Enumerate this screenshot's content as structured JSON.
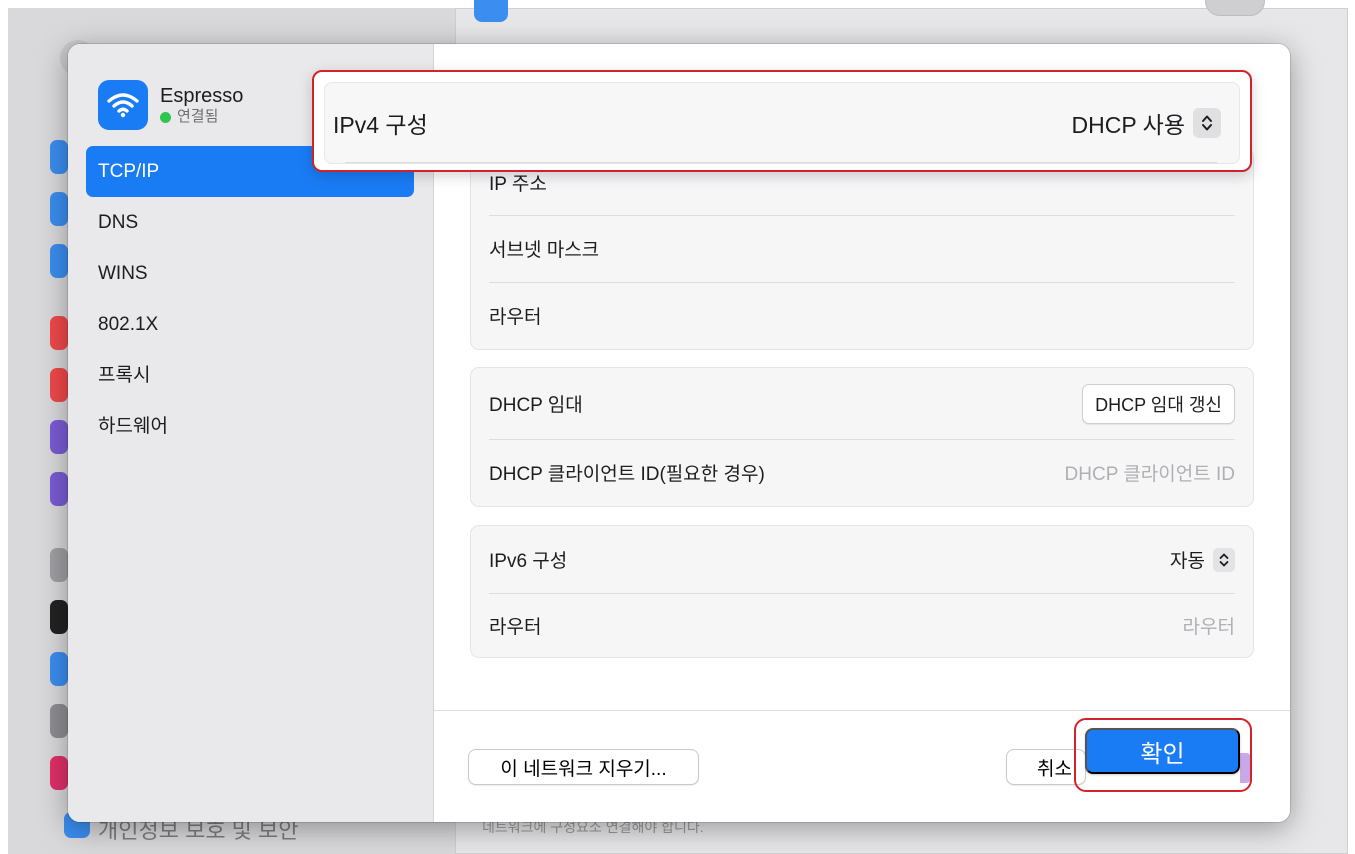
{
  "background": {
    "bottom_sidebar_label": "개인정보 보호 및 보안",
    "bottom_content_text": "네트워크에 구성요소 연결해야 합니다."
  },
  "sidebar": {
    "network_name": "Espresso",
    "network_status": "연결됨",
    "items": [
      {
        "label": "TCP/IP",
        "active": true
      },
      {
        "label": "DNS"
      },
      {
        "label": "WINS"
      },
      {
        "label": "802.1X"
      },
      {
        "label": "프록시"
      },
      {
        "label": "하드웨어"
      }
    ]
  },
  "ipv4": {
    "label": "IPv4 구성",
    "value": "DHCP 사용"
  },
  "addr_group": {
    "ip_label": "IP 주소",
    "subnet_label": "서브넷 마스크",
    "router_label": "라우터"
  },
  "dhcp_group": {
    "lease_label": "DHCP 임대",
    "renew_button": "DHCP 임대 갱신",
    "client_id_label": "DHCP 클라이언트 ID(필요한 경우)",
    "client_id_placeholder": "DHCP 클라이언트 ID"
  },
  "ipv6_group": {
    "config_label": "IPv6 구성",
    "config_value": "자동",
    "router_label": "라우터",
    "router_value": "라우터"
  },
  "footer": {
    "forget_button": "이 네트워크 지우기...",
    "cancel_button": "취소",
    "ok_button": "확인"
  },
  "colors": {
    "accent": "#1a7cf5",
    "highlight": "#d2232a",
    "status_connected": "#30c451"
  }
}
